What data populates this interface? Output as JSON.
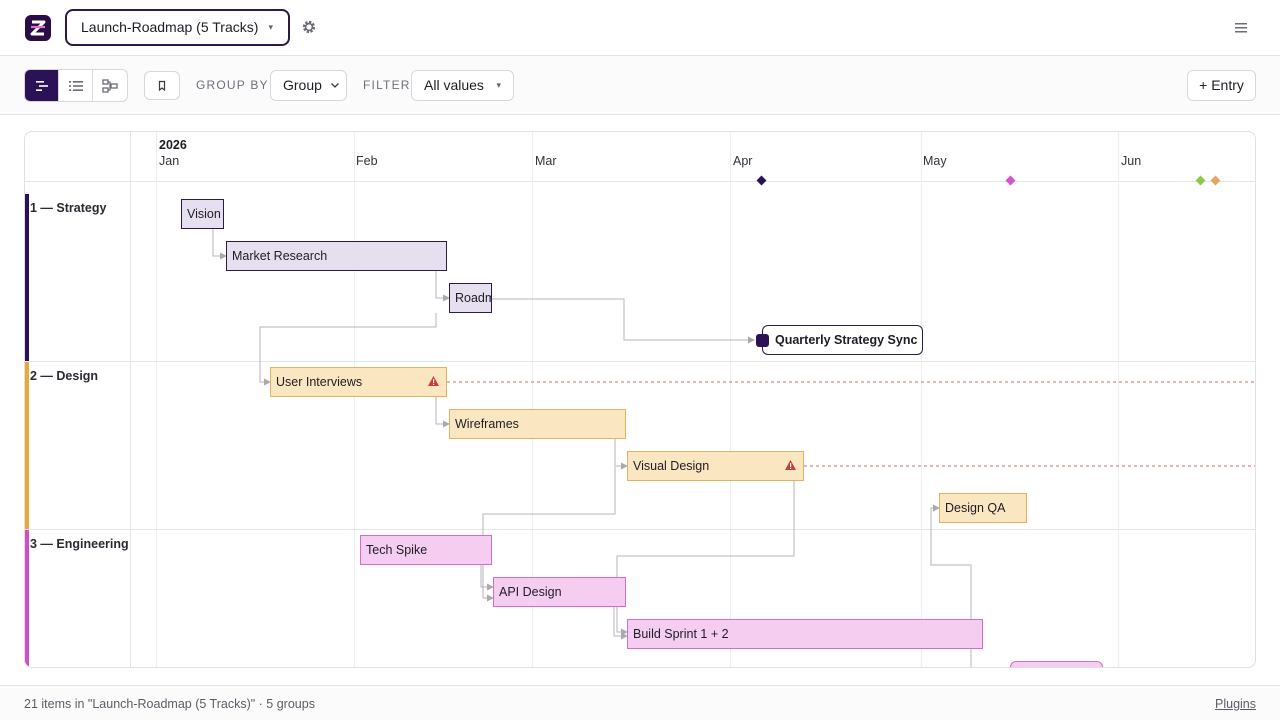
{
  "app": {
    "logo_letter": "Z",
    "logo_color": "#2b0d45"
  },
  "header": {
    "board_name": "Launch-Roadmap (5 Tracks)",
    "settings_icon": "gear-icon",
    "menu_icon": "hamburger-icon"
  },
  "toolbar": {
    "views": [
      {
        "name": "timeline",
        "icon": "timeline-icon",
        "active": true
      },
      {
        "name": "list",
        "icon": "list-icon",
        "active": false
      },
      {
        "name": "tree",
        "icon": "hierarchy-icon",
        "active": false
      }
    ],
    "bookmark_icon": "bookmark-icon",
    "group_by_label": "GROUP BY",
    "group_by_value": "Group",
    "filter_label": "FILTER",
    "filter_value": "All values",
    "add_entry_label": "+ Entry"
  },
  "timeline": {
    "year": "2026",
    "months": [
      "Jan",
      "Feb",
      "Mar",
      "Apr",
      "May",
      "Jun"
    ],
    "groups": [
      {
        "label": "1 — Strategy",
        "color": "#2b1257"
      },
      {
        "label": "2 — Design",
        "color": "#e8a83c"
      },
      {
        "label": "3 — Engineering",
        "color": "#d14fc4"
      }
    ],
    "milestone_markers": [
      {
        "color": "#2b1257"
      },
      {
        "color": "#d94fd0"
      },
      {
        "color": "#8cc84b"
      },
      {
        "color": "#e0a868"
      }
    ],
    "tasks": [
      {
        "label": "Vision",
        "group": 0
      },
      {
        "label": "Market Research",
        "group": 0
      },
      {
        "label": "Roadmap",
        "group": 0
      },
      {
        "label": "Quarterly Strategy Sync",
        "group": 0,
        "milestone": true
      },
      {
        "label": "User Interviews",
        "group": 1,
        "warning": true
      },
      {
        "label": "Wireframes",
        "group": 1
      },
      {
        "label": "Visual Design",
        "group": 1,
        "warning": true
      },
      {
        "label": "Design QA",
        "group": 1
      },
      {
        "label": "Tech Spike",
        "group": 2
      },
      {
        "label": "API Design",
        "group": 2
      },
      {
        "label": "Build Sprint 1 + 2",
        "group": 2
      }
    ],
    "colors": {
      "strategy_fill": "#e6dff0",
      "strategy_border": "#2b1a4a",
      "design_fill": "#fbe6c2",
      "design_border": "#e2b25e",
      "eng_fill": "#f5cdf0",
      "eng_border": "#d36ccb",
      "warning": "#cc3b3b"
    }
  },
  "footer": {
    "summary": "21 items in \"Launch-Roadmap (5 Tracks)\" · 5 groups",
    "plugins_label": "Plugins"
  }
}
